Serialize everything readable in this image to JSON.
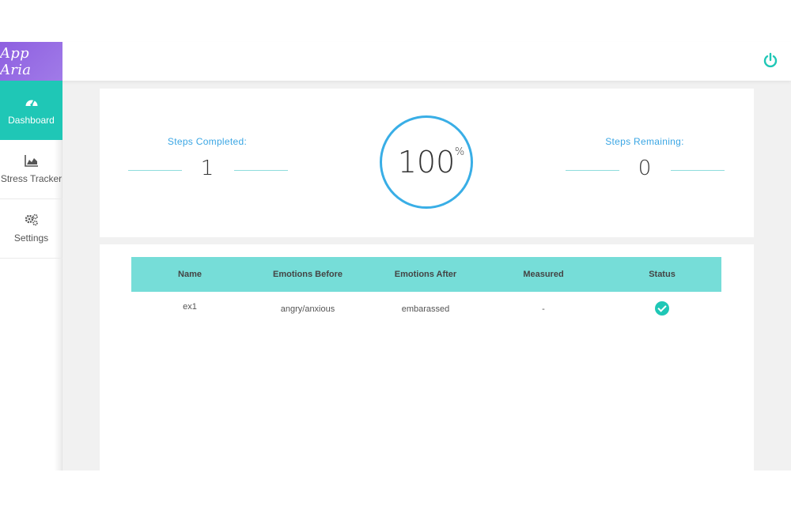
{
  "app": {
    "title": "App Aria"
  },
  "sidebar": {
    "items": [
      {
        "label": "Dashboard",
        "icon": "dashboard-gauge-icon",
        "active": true
      },
      {
        "label": "Stress Tracker",
        "icon": "area-chart-icon",
        "active": false
      },
      {
        "label": "Settings",
        "icon": "gears-icon",
        "active": false
      }
    ]
  },
  "header": {
    "power_icon": "power-icon"
  },
  "stats": {
    "completed_label": "Steps Completed:",
    "completed_value": "1",
    "progress_value": "100",
    "progress_unit": "%",
    "remaining_label": "Steps Remaining:",
    "remaining_value": "0"
  },
  "table": {
    "headers": [
      "Name",
      "Emotions Before",
      "Emotions After",
      "Measured",
      "Status"
    ],
    "rows": [
      {
        "name": "ex1",
        "before": "angry/anxious",
        "after": "embarassed",
        "measured": "-",
        "status": "complete"
      }
    ]
  },
  "colors": {
    "accent": "#1fc7b6",
    "brand": "#8e5fe0",
    "ring": "#39aee6",
    "table_header": "#76ddd8"
  }
}
